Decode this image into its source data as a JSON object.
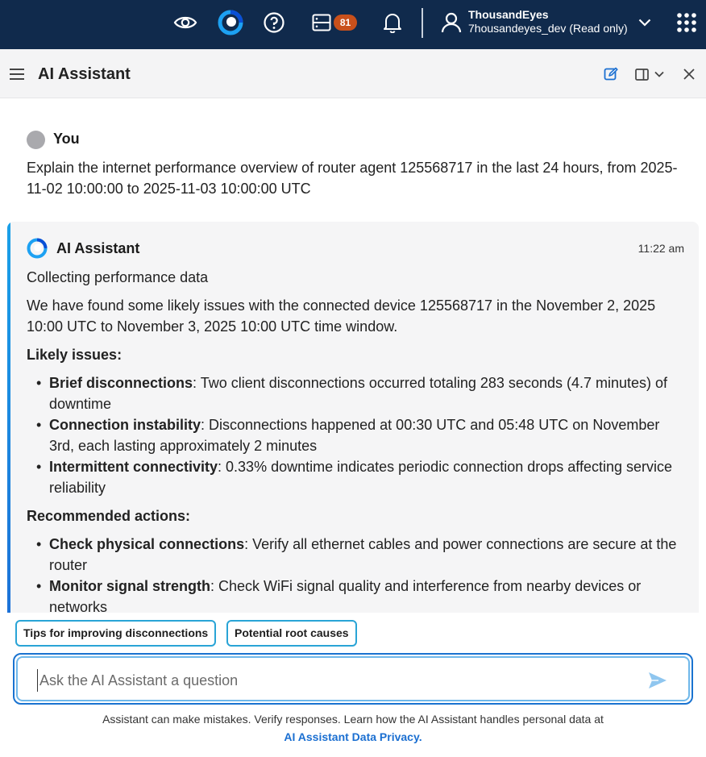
{
  "topbar": {
    "icons": [
      "eye-icon",
      "thousandeyes-logo-icon",
      "help-icon",
      "alerts-icon",
      "bell-icon",
      "user-icon",
      "chevron-down-icon",
      "apps-grid-icon"
    ],
    "alerts_count": "81",
    "account_name": "ThousandEyes",
    "account_sub": "7housandeyes_dev (Read only)"
  },
  "panel": {
    "title": "AI Assistant",
    "icons": [
      "menu-icon",
      "new-chat-icon",
      "panel-layout-icon",
      "chevron-down-icon",
      "close-icon"
    ]
  },
  "conversation": {
    "user": {
      "name": "You",
      "message": "Explain the internet performance overview of router agent 125568717 in the last 24 hours, from 2025-11-02 10:00:00 to 2025-11-03 10:00:00 UTC"
    },
    "assistant": {
      "name": "AI Assistant",
      "time": "11:22 am",
      "status": "Collecting performance data",
      "intro": "We have found some likely issues with the connected device 125568717 in the November 2, 2025 10:00 UTC to November 3, 2025 10:00 UTC time window.",
      "issues_heading": "Likely issues:",
      "issues": [
        {
          "title": "Brief disconnections",
          "text": ": Two client disconnections occurred totaling 283 seconds (4.7 minutes) of downtime"
        },
        {
          "title": "Connection instability",
          "text": ": Disconnections happened at 00:30 UTC and 05:48 UTC on November 3rd, each lasting approximately 2 minutes"
        },
        {
          "title": "Intermittent connectivity",
          "text": ": 0.33% downtime indicates periodic connection drops affecting service reliability"
        }
      ],
      "actions_heading": "Recommended actions:",
      "actions": [
        {
          "title": "Check physical connections",
          "text": ": Verify all ethernet cables and power connections are secure at the router"
        },
        {
          "title": "Monitor signal strength",
          "text": ": Check WiFi signal quality and interference from nearby devices or networks"
        }
      ]
    }
  },
  "composer": {
    "suggestions": [
      "Tips for improving disconnections",
      "Potential root causes"
    ],
    "placeholder": "Ask the AI Assistant a question",
    "disclaimer": "Assistant can make mistakes. Verify responses. Learn how the AI Assistant handles personal data at",
    "privacy_link": "AI Assistant Data Privacy."
  },
  "colors": {
    "topbar_bg": "#102a4c",
    "badge": "#c8501b",
    "accent_blue": "#1b6fd1",
    "chip_border": "#29a4d6",
    "send_icon": "#8fc6ef"
  }
}
